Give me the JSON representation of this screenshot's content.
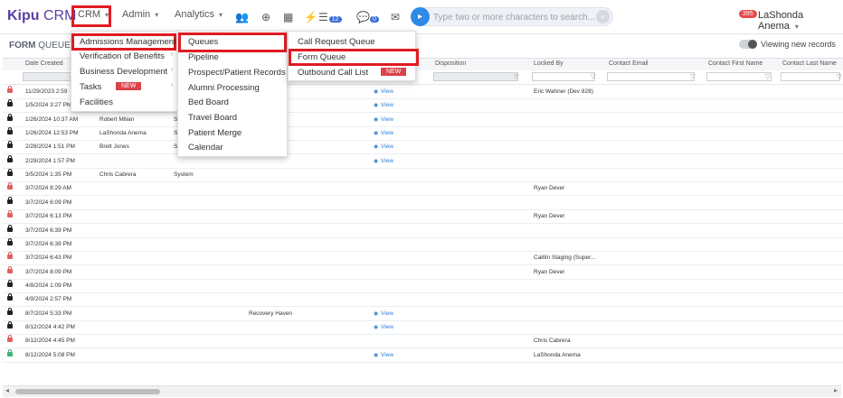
{
  "app": {
    "logo_kipu": "Kipu",
    "logo_crm": "CRM"
  },
  "nav": {
    "crm": "CRM",
    "admin": "Admin",
    "analytics": "Analytics",
    "search_placeholder": "Type two or more characters to search...",
    "notif_count": "395",
    "user_name": "LaShonda Anema",
    "task_count": "12",
    "chat_count": "0"
  },
  "page": {
    "title_bold": "FORM",
    "title_rest": "QUEUE",
    "toggle_label": "Viewing new records"
  },
  "columns": {
    "date_created": "Date Created",
    "disposition": "Disposition",
    "locked_by": "Locked By",
    "contact_email": "Contact Email",
    "contact_first": "Contact First Name",
    "contact_last": "Contact Last Name"
  },
  "rows": [
    {
      "date": "11/29/2023 2:59",
      "c2": "",
      "c3": "",
      "c4": "",
      "view": "View",
      "locked": "Eric Wahner (Dev 828)",
      "lock": "red"
    },
    {
      "date": "1/5/2024 3:27 PM",
      "c2": "",
      "c3": "",
      "c4": "n",
      "view": "View",
      "locked": "",
      "lock": "black"
    },
    {
      "date": "1/26/2024 10:37 AM",
      "c2": "Robert Milian",
      "c3": "S",
      "c4": "",
      "view": "View",
      "locked": "",
      "lock": "black"
    },
    {
      "date": "1/26/2024 12:53 PM",
      "c2": "LaShonda Anema",
      "c3": "S",
      "c4": "",
      "view": "View",
      "locked": "",
      "lock": "black"
    },
    {
      "date": "2/28/2024 1:51 PM",
      "c2": "Brett Jones",
      "c3": "S",
      "c4": "",
      "view": "View",
      "locked": "",
      "lock": "black"
    },
    {
      "date": "2/28/2024 1:57 PM",
      "c2": "",
      "c3": "",
      "c4": "",
      "view": "View",
      "locked": "",
      "lock": "black"
    },
    {
      "date": "3/5/2024 1:35 PM",
      "c2": "Chris Cabrera",
      "c3": "System",
      "c4": "",
      "view": "",
      "locked": "",
      "lock": "black"
    },
    {
      "date": "3/7/2024 8:29 AM",
      "c2": "",
      "c3": "",
      "c4": "",
      "view": "",
      "locked": "Ryan Dever",
      "lock": "red"
    },
    {
      "date": "3/7/2024 6:09 PM",
      "c2": "",
      "c3": "",
      "c4": "",
      "view": "",
      "locked": "",
      "lock": "black"
    },
    {
      "date": "3/7/2024 6:13 PM",
      "c2": "",
      "c3": "",
      "c4": "",
      "view": "",
      "locked": "Ryan Dever",
      "lock": "red"
    },
    {
      "date": "3/7/2024 6:39 PM",
      "c2": "",
      "c3": "",
      "c4": "",
      "view": "",
      "locked": "",
      "lock": "black"
    },
    {
      "date": "3/7/2024 6:39 PM",
      "c2": "",
      "c3": "",
      "c4": "",
      "view": "",
      "locked": "",
      "lock": "black"
    },
    {
      "date": "3/7/2024 6:43 PM",
      "c2": "",
      "c3": "",
      "c4": "",
      "view": "",
      "locked": "Caitlin Staging (Super...",
      "lock": "red"
    },
    {
      "date": "3/7/2024 8:09 PM",
      "c2": "",
      "c3": "",
      "c4": "",
      "view": "",
      "locked": "Ryan Dever",
      "lock": "red"
    },
    {
      "date": "4/8/2024 1:09 PM",
      "c2": "",
      "c3": "",
      "c4": "",
      "view": "",
      "locked": "",
      "lock": "black"
    },
    {
      "date": "4/9/2024 2:57 PM",
      "c2": "",
      "c3": "",
      "c4": "",
      "view": "",
      "locked": "",
      "lock": "black"
    },
    {
      "date": "8/7/2024 5:33 PM",
      "c2": "",
      "c3": "",
      "c4": "Recovery Haven",
      "view": "View",
      "locked": "",
      "lock": "black"
    },
    {
      "date": "8/12/2024 4:42 PM",
      "c2": "",
      "c3": "",
      "c4": "",
      "view": "View",
      "locked": "",
      "lock": "black"
    },
    {
      "date": "8/12/2024 4:45 PM",
      "c2": "",
      "c3": "",
      "c4": "",
      "view": "",
      "locked": "Chris Cabrera",
      "lock": "red"
    },
    {
      "date": "8/12/2024 5:08 PM",
      "c2": "",
      "c3": "",
      "c4": "",
      "view": "View",
      "locked": "LaShonda Anema",
      "lock": "green"
    }
  ],
  "menu1": {
    "admissions": "Admissions Management",
    "vob": "Verification of Benefits",
    "bizdev": "Business Development",
    "tasks": "Tasks",
    "tasks_new": "NEW",
    "facilities": "Facilities"
  },
  "menu2": {
    "queues": "Queues",
    "pipeline": "Pipeline",
    "prospect": "Prospect/Patient Records",
    "alumni": "Alumni Processing",
    "bedboard": "Bed Board",
    "travel": "Travel Board",
    "merge": "Patient Merge",
    "calendar": "Calendar"
  },
  "menu3": {
    "call_request": "Call Request Queue",
    "form_queue": "Form Queue",
    "outbound": "Outbound Call List",
    "outbound_new": "NEW"
  },
  "colors": {
    "accent": "#5b3fa0",
    "highlight": "#e01b22",
    "link": "#2f7fd6",
    "new_badge": "#d9434a",
    "lock_red": "#e06060",
    "lock_green": "#3cb371",
    "lock_black": "#222222"
  }
}
